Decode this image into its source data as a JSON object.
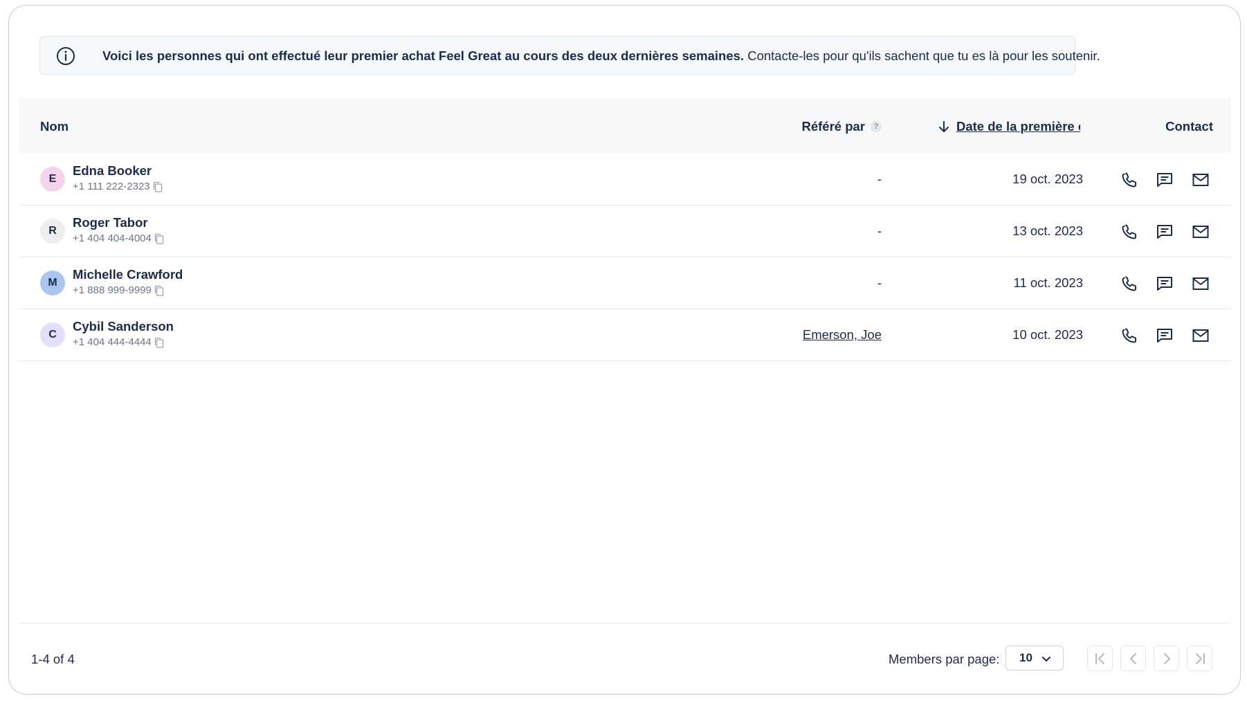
{
  "banner": {
    "bold_text": "Voici les personnes qui ont effectué leur premier achat Feel Great au cours des deux dernières semaines.",
    "text": "Contacte-les pour qu'ils sachent que tu es là pour les soutenir.",
    "icon": "info-icon"
  },
  "table": {
    "headers": {
      "name": "Nom",
      "referred_by": "Référé par",
      "referred_help": "?",
      "date": "Date de la première commande",
      "contact": "Contact"
    },
    "sort": {
      "column": "date",
      "direction": "descending"
    },
    "rows": [
      {
        "initial": "E",
        "avatar_color": "#f3d3ee",
        "name": "Edna Booker",
        "phone": "+1 111 222-2323",
        "referred_by": "-",
        "referred_link": false,
        "date": "19 oct. 2023"
      },
      {
        "initial": "R",
        "avatar_color": "#eceef0",
        "name": "Roger Tabor",
        "phone": "+1 404 404-4004",
        "referred_by": "-",
        "referred_link": false,
        "date": "13 oct. 2023"
      },
      {
        "initial": "M",
        "avatar_color": "#a9c6ec",
        "name": "Michelle Crawford",
        "phone": "+1 888 999-9999",
        "referred_by": "-",
        "referred_link": false,
        "date": "11 oct. 2023"
      },
      {
        "initial": "C",
        "avatar_color": "#e2e0fb",
        "name": "Cybil Sanderson",
        "phone": "+1 404 444-4444",
        "referred_by": "Emerson, Joe",
        "referred_link": true,
        "date": "10 oct. 2023"
      }
    ]
  },
  "footer": {
    "range": "1-4 of 4",
    "per_page_label": "Members par page:",
    "per_page_value": "10"
  },
  "colors": {
    "text": "#1c2b4a",
    "muted": "#6b7585",
    "header_bg": "#f6f8f9",
    "banner_bg": "#f4f8fb"
  }
}
